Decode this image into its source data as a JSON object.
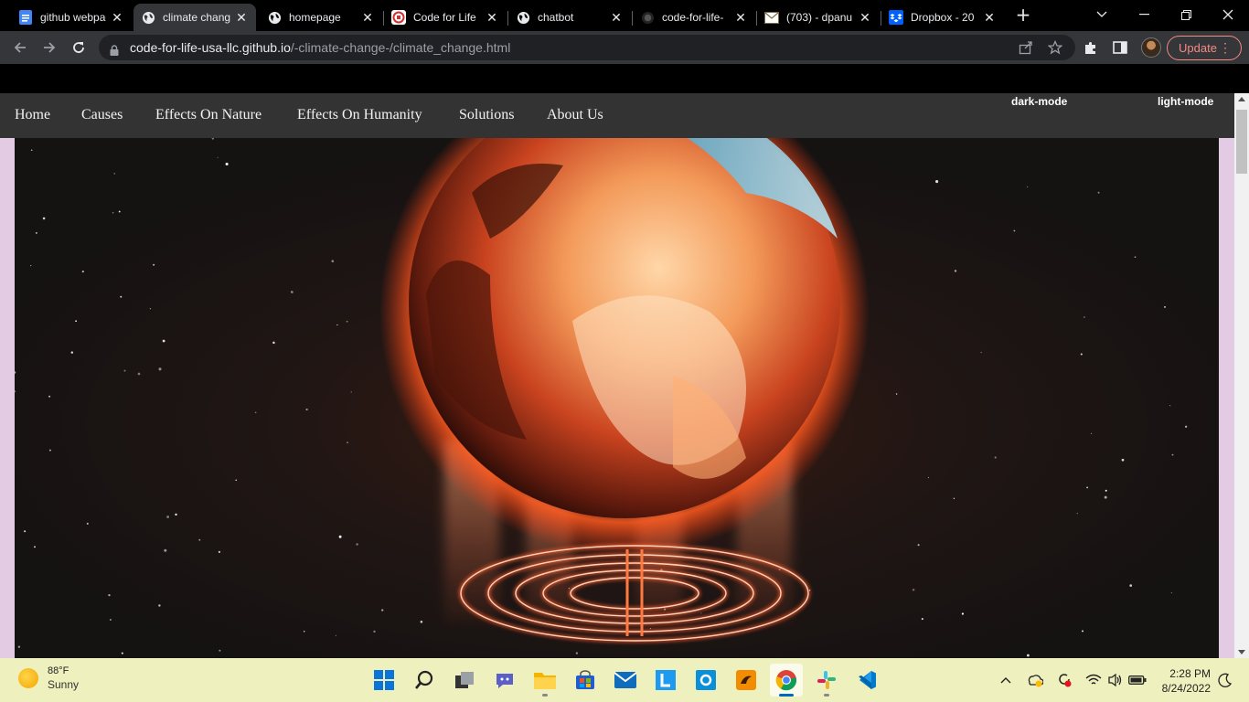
{
  "browser": {
    "tabs": [
      {
        "title": "github webpage",
        "icon": "google-docs-icon"
      },
      {
        "title": "climate change",
        "icon": "globe-icon",
        "active": true
      },
      {
        "title": "homepage",
        "icon": "globe-icon"
      },
      {
        "title": "Code for Life",
        "icon": "code-for-life-icon"
      },
      {
        "title": "chatbot",
        "icon": "globe-icon"
      },
      {
        "title": "code-for-life-",
        "icon": "github-icon"
      },
      {
        "title": "(703) - dpanu",
        "icon": "mail-icon"
      },
      {
        "title": "Dropbox - 20",
        "icon": "dropbox-icon"
      }
    ],
    "url_host": "code-for-life-usa-llc.github.io",
    "url_path": "/-climate-change-/climate_change.html",
    "update_label": "Update"
  },
  "site": {
    "nav": [
      "Home",
      "Causes",
      "Effects On Nature",
      "Effects On Humanity",
      "Solutions",
      "About Us"
    ],
    "dark_mode_label": "dark-mode",
    "light_mode_label": "light-mode",
    "hero_image": "burning earth over glowing labyrinth"
  },
  "taskbar": {
    "weather_temp": "88°F",
    "weather_condition": "Sunny",
    "apps": [
      "windows-start-icon",
      "search-icon",
      "task-view-icon",
      "teams-chat-icon",
      "file-explorer-icon",
      "store-icon",
      "mail-icon",
      "lapp-icon",
      "outlook-icon",
      "folder-app-icon",
      "chrome-icon",
      "slack-icon",
      "vscode-icon"
    ],
    "time": "2:28 PM",
    "date": "8/24/2022"
  },
  "colors": {
    "tab_bg": "#000000",
    "active_tab": "#35363a",
    "nav_bg": "#333333",
    "page_bg": "#e3cce3",
    "taskbar": "#eef1bd",
    "update_accent": "#f28b82"
  }
}
